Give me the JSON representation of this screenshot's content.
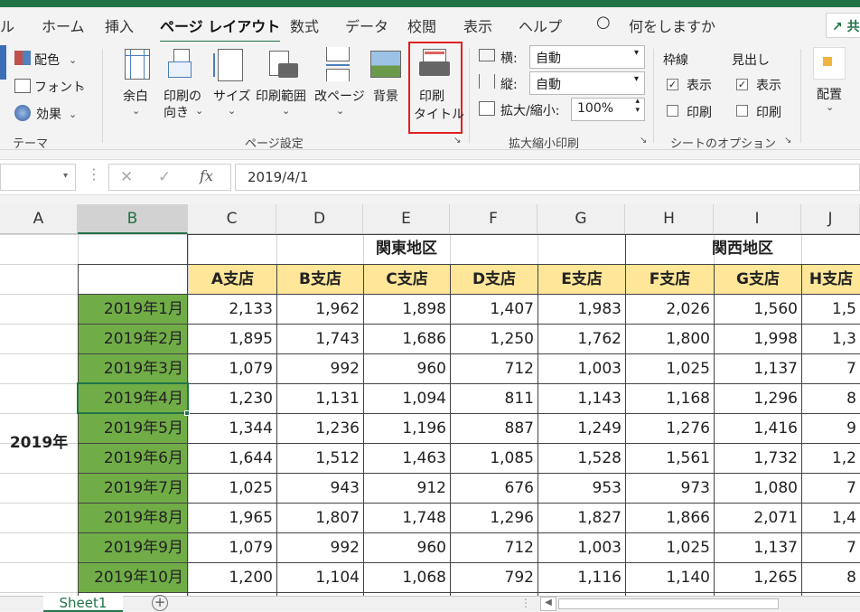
{
  "tabs": [
    "ル",
    "ホーム",
    "挿入",
    "ページ レイアウト",
    "数式",
    "データ",
    "校閲",
    "表示",
    "ヘルプ",
    "何をしますか"
  ],
  "share_label": "共",
  "ribbon": {
    "theme": {
      "colors": "配色",
      "fonts": "フォント",
      "effects": "効果",
      "group": "テーマ"
    },
    "page_setup": {
      "margins": "余白",
      "orientation": [
        "印刷の",
        "向き"
      ],
      "size": "サイズ",
      "print_area": "印刷範囲",
      "breaks": "改ページ",
      "background": "背景",
      "print_titles": [
        "印刷",
        "タイトル"
      ],
      "group": "ページ設定"
    },
    "scale": {
      "width_label": "横:",
      "width_value": "自動",
      "height_label": "縦:",
      "height_value": "自動",
      "scale_label": "拡大/縮小:",
      "scale_value": "100%",
      "group": "拡大縮小印刷"
    },
    "sheet_options": {
      "gridlines": "枠線",
      "headings": "見出し",
      "view": "表示",
      "print": "印刷",
      "group": "シートのオプション"
    },
    "arrange": {
      "label": "配置"
    }
  },
  "formula_bar": {
    "fx": "fx",
    "value": "2019/4/1"
  },
  "columns": [
    "A",
    "B",
    "C",
    "D",
    "E",
    "F",
    "G",
    "H",
    "I",
    "J"
  ],
  "selected_column": "B",
  "header": {
    "region_east": "関東地区",
    "region_west": "関西地区",
    "branches": [
      "A支店",
      "B支店",
      "C支店",
      "D支店",
      "E支店",
      "F支店",
      "G支店",
      "H支店"
    ]
  },
  "year_label": "2019年",
  "months": [
    "2019年1月",
    "2019年2月",
    "2019年3月",
    "2019年4月",
    "2019年5月",
    "2019年6月",
    "2019年7月",
    "2019年8月",
    "2019年9月",
    "2019年10月"
  ],
  "rows": [
    [
      "2,133",
      "1,962",
      "1,898",
      "1,407",
      "1,983",
      "2,026",
      "1,560",
      "1,5"
    ],
    [
      "1,895",
      "1,743",
      "1,686",
      "1,250",
      "1,762",
      "1,800",
      "1,998",
      "1,3"
    ],
    [
      "1,079",
      "992",
      "960",
      "712",
      "1,003",
      "1,025",
      "1,137",
      "7"
    ],
    [
      "1,230",
      "1,131",
      "1,094",
      "811",
      "1,143",
      "1,168",
      "1,296",
      "8"
    ],
    [
      "1,344",
      "1,236",
      "1,196",
      "887",
      "1,249",
      "1,276",
      "1,416",
      "9"
    ],
    [
      "1,644",
      "1,512",
      "1,463",
      "1,085",
      "1,528",
      "1,561",
      "1,732",
      "1,2"
    ],
    [
      "1,025",
      "943",
      "912",
      "676",
      "953",
      "973",
      "1,080",
      "7"
    ],
    [
      "1,965",
      "1,807",
      "1,748",
      "1,296",
      "1,827",
      "1,866",
      "2,071",
      "1,4"
    ],
    [
      "1,079",
      "992",
      "960",
      "712",
      "1,003",
      "1,025",
      "1,137",
      "7"
    ],
    [
      "1,200",
      "1,104",
      "1,068",
      "792",
      "1,116",
      "1,140",
      "1,265",
      "8"
    ]
  ],
  "sheet_tab": "Sheet1",
  "colors": {
    "accent": "#217346",
    "month_fill": "#70ad47",
    "header_fill": "#ffe699",
    "highlight": "#e02020"
  }
}
